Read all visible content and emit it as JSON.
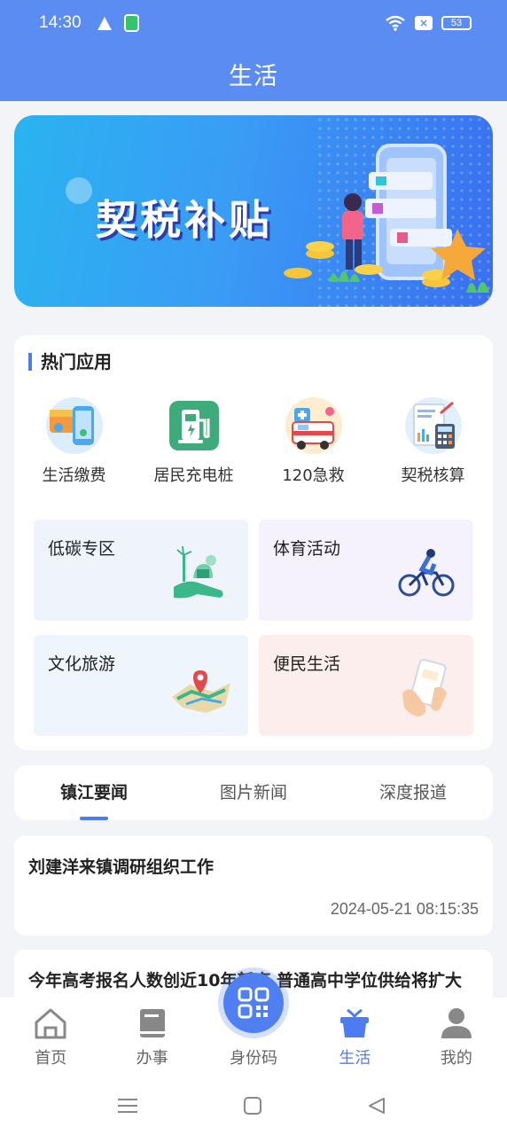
{
  "status_bar": {
    "time": "14:30",
    "battery": "53"
  },
  "header": {
    "title": "生活"
  },
  "banner": {
    "text": "契税补贴"
  },
  "hot_apps": {
    "title": "热门应用",
    "apps": [
      {
        "label": "生活缴费",
        "icon": "wallet-phone-icon"
      },
      {
        "label": "居民充电桩",
        "icon": "charging-station-icon"
      },
      {
        "label": "120急救",
        "icon": "ambulance-icon"
      },
      {
        "label": "契税核算",
        "icon": "calculator-icon"
      }
    ],
    "tiles": [
      {
        "label": "低碳专区",
        "icon": "green-energy-icon"
      },
      {
        "label": "体育活动",
        "icon": "cyclist-icon"
      },
      {
        "label": "文化旅游",
        "icon": "map-pin-icon"
      },
      {
        "label": "便民生活",
        "icon": "phone-in-hand-icon"
      }
    ]
  },
  "news_tabs": [
    "镇江要闻",
    "图片新闻",
    "深度报道"
  ],
  "news": [
    {
      "title": "刘建洋来镇调研组织工作",
      "date": "2024-05-21 08:15:35"
    },
    {
      "title": "今年高考报名人数创近10年新高 普通高中学位供给将扩大"
    }
  ],
  "bottom_nav": [
    {
      "label": "首页",
      "icon": "home-icon"
    },
    {
      "label": "办事",
      "icon": "book-icon"
    },
    {
      "label": "身份码",
      "icon": "qr-code-icon"
    },
    {
      "label": "生活",
      "icon": "gift-icon"
    },
    {
      "label": "我的",
      "icon": "user-icon"
    }
  ],
  "colors": {
    "primary": "#5b8cf2",
    "accent": "#4c7cf0"
  }
}
